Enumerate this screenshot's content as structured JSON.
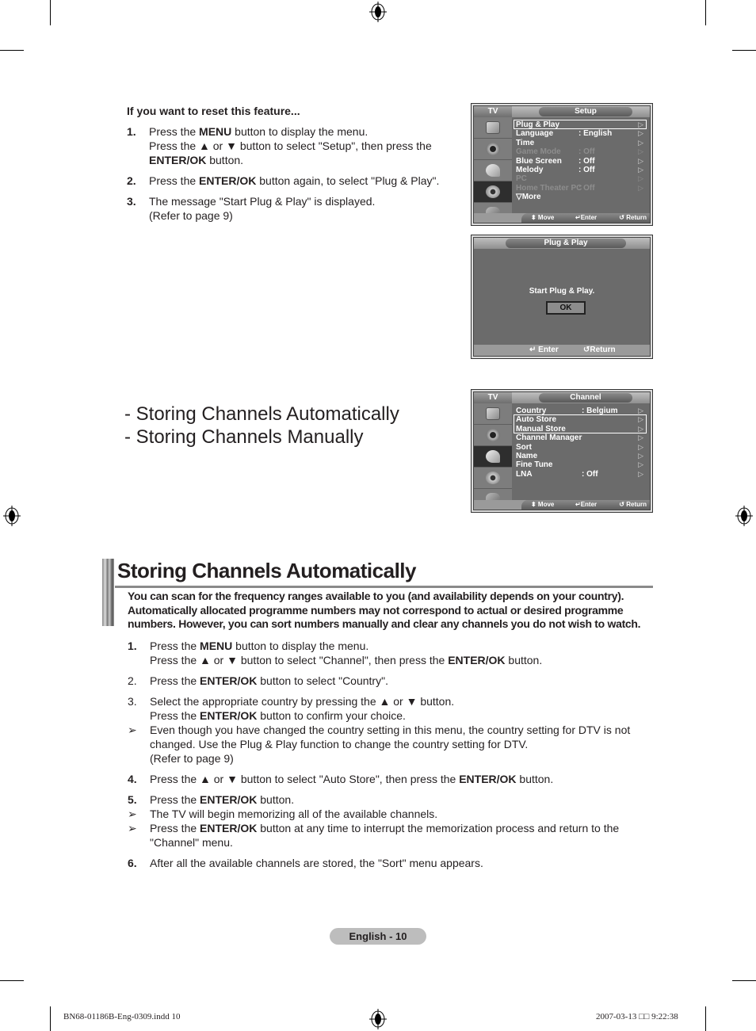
{
  "reset": {
    "title": "If you want to reset this feature...",
    "steps": [
      {
        "num": "1.",
        "lines": [
          [
            {
              "t": "Press the "
            },
            {
              "b": "MENU"
            },
            {
              "t": " button to display the menu."
            }
          ],
          [
            {
              "t": "Press the ▲ or ▼ button to select \"Setup\", then press the"
            }
          ],
          [
            {
              "b": "ENTER/OK"
            },
            {
              "t": " button."
            }
          ]
        ]
      },
      {
        "num": "2.",
        "lines": [
          [
            {
              "t": "Press the "
            },
            {
              "b": "ENTER/OK"
            },
            {
              "t": " button again, to select \"Plug & Play\"."
            }
          ]
        ]
      },
      {
        "num": "3.",
        "lines": [
          [
            {
              "t": "The message \"Start Plug & Play\" is displayed."
            }
          ],
          [
            {
              "t": "(Refer to page 9)"
            }
          ]
        ]
      }
    ]
  },
  "setup_screen": {
    "tv_label": "TV",
    "title": "Setup",
    "items": [
      {
        "label": "Plug & Play",
        "value": "",
        "dim": false,
        "selected": true
      },
      {
        "label": "Language",
        "value": ": English",
        "dim": false
      },
      {
        "label": "Time",
        "value": "",
        "dim": false
      },
      {
        "label": "Game Mode",
        "value": ": Off",
        "dim": true
      },
      {
        "label": "Blue Screen",
        "value": ": Off",
        "dim": false
      },
      {
        "label": "Melody",
        "value": ": Off",
        "dim": false
      },
      {
        "label": "PC",
        "value": "",
        "dim": true
      },
      {
        "label": "Home Theater PC",
        "value": ": Off",
        "dim": true
      },
      {
        "label": "▽More",
        "value": "",
        "dim": false,
        "no_arrow": true
      }
    ],
    "footer": {
      "move": "⬍ Move",
      "enter": "↵Enter",
      "return": "↺ Return"
    }
  },
  "plugplay_screen": {
    "title": "Plug & Play",
    "message": "Start Plug & Play.",
    "ok_label": "OK",
    "footer": {
      "enter": "↵ Enter",
      "return": "↺Return"
    }
  },
  "channel_screen": {
    "tv_label": "TV",
    "title": "Channel",
    "items": [
      {
        "label": "Country",
        "value": ": Belgium"
      },
      {
        "label": "Auto Store",
        "value": "",
        "selected": true
      },
      {
        "label": "Manual Store",
        "value": "",
        "selected": true
      },
      {
        "label": "Channel Manager",
        "value": ""
      },
      {
        "label": "Sort",
        "value": ""
      },
      {
        "label": "Name",
        "value": ""
      },
      {
        "label": "Fine Tune",
        "value": ""
      },
      {
        "label": "LNA",
        "value": ": Off"
      }
    ],
    "footer": {
      "move": "⬍ Move",
      "enter": "↵Enter",
      "return": "↺ Return"
    }
  },
  "subheadings": [
    "- Storing Channels Automatically",
    "- Storing Channels Manually"
  ],
  "section": {
    "title": "Storing Channels Automatically",
    "intro": "You can scan for the frequency ranges available to you (and availability depends on your country). Automatically allocated programme numbers may not correspond to actual or desired programme numbers. However, you can sort numbers manually and clear any channels you do not wish to watch.",
    "steps": [
      {
        "num": "1.",
        "bold_num": true,
        "lines": [
          [
            {
              "t": "Press the "
            },
            {
              "b": "MENU"
            },
            {
              "t": " button to display the menu."
            }
          ],
          [
            {
              "t": "Press the ▲ or ▼ button to select \"Channel\", then press the "
            },
            {
              "b": "ENTER/OK"
            },
            {
              "t": " button."
            }
          ]
        ]
      },
      {
        "num": "2.",
        "bold_num": false,
        "lines": [
          [
            {
              "t": "Press the "
            },
            {
              "b": "ENTER/OK"
            },
            {
              "t": " button to select \"Country\"."
            }
          ]
        ]
      },
      {
        "num": "3.",
        "bold_num": false,
        "gap": false,
        "lines": [
          [
            {
              "t": "Select the appropriate country by pressing the ▲ or ▼ button."
            }
          ],
          [
            {
              "t": "Press the "
            },
            {
              "b": "ENTER/OK"
            },
            {
              "t": " button to confirm your choice."
            }
          ]
        ]
      },
      {
        "num": "➢",
        "note": true,
        "lines": [
          [
            {
              "t": "Even though you have changed the country setting in this menu, the country setting for DTV is not"
            }
          ],
          [
            {
              "t": "changed. Use the Plug & Play function to change the country setting for DTV."
            }
          ],
          [
            {
              "t": "(Refer to page 9)"
            }
          ]
        ]
      },
      {
        "num": "4.",
        "bold_num": true,
        "lines": [
          [
            {
              "t": "Press the ▲ or ▼ button to select \"Auto Store\", then press the "
            },
            {
              "b": "ENTER/OK"
            },
            {
              "t": " button."
            }
          ]
        ]
      },
      {
        "num": "5.",
        "bold_num": true,
        "gap": false,
        "lines": [
          [
            {
              "t": "Press the "
            },
            {
              "b": "ENTER/OK"
            },
            {
              "t": " button."
            }
          ]
        ]
      },
      {
        "num": "➢",
        "note": true,
        "gap": false,
        "lines": [
          [
            {
              "t": "The TV will begin memorizing all of the available channels."
            }
          ]
        ]
      },
      {
        "num": "➢",
        "note": true,
        "lines": [
          [
            {
              "t": "Press the "
            },
            {
              "b": "ENTER/OK"
            },
            {
              "t": " button at any time to interrupt the memorization process and return to the"
            }
          ],
          [
            {
              "t": "\"Channel\" menu."
            }
          ]
        ]
      },
      {
        "num": "6.",
        "bold_num": true,
        "lines": [
          [
            {
              "t": "After all the available channels are stored, the \"Sort\" menu appears."
            }
          ]
        ]
      }
    ]
  },
  "page_label": "English - 10",
  "slug": {
    "file": "BN68-01186B-Eng-0309.indd   10",
    "timestamp": "2007-03-13   □□ 9:22:38"
  }
}
